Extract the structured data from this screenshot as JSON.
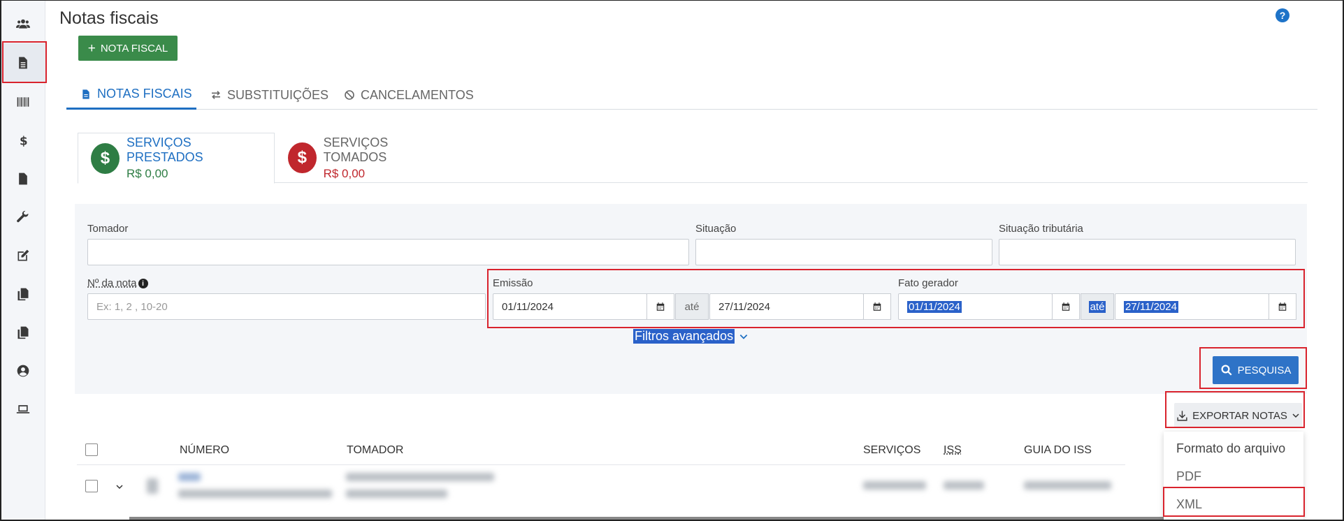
{
  "page": {
    "title": "Notas fiscais",
    "help_icon": "question-icon"
  },
  "sidebar": {
    "items": [
      {
        "icon": "users-icon"
      },
      {
        "icon": "file-text-icon",
        "active": true
      },
      {
        "icon": "barcode-icon"
      },
      {
        "icon": "dollar-icon"
      },
      {
        "icon": "file-icon"
      },
      {
        "icon": "wrench-icon"
      },
      {
        "icon": "edit-icon"
      },
      {
        "icon": "copy-icon"
      },
      {
        "icon": "copy-alt-icon"
      },
      {
        "icon": "user-circle-icon"
      },
      {
        "icon": "laptop-icon"
      }
    ]
  },
  "toolbar": {
    "new_label": "NOTA FISCAL"
  },
  "tabs": [
    {
      "label": "NOTAS FISCAIS",
      "icon": "file-text-icon",
      "active": true
    },
    {
      "label": "SUBSTITUIÇÕES",
      "icon": "exchange-icon"
    },
    {
      "label": "CANCELAMENTOS",
      "icon": "ban-icon"
    }
  ],
  "subtabs": [
    {
      "title": "SERVIÇOS PRESTADOS",
      "value": "R$ 0,00",
      "color": "#2e7d44",
      "active": true
    },
    {
      "title": "SERVIÇOS TOMADOS",
      "value": "R$ 0,00",
      "color": "#c0272d"
    }
  ],
  "filters": {
    "tomador_label": "Tomador",
    "situacao_label": "Situação",
    "situacao_tributaria_label": "Situação tributária",
    "numero_label": "Nº da nota",
    "numero_placeholder": "Ex: 1, 2 , 10-20",
    "emissao_label": "Emissão",
    "emissao_from": "01/11/2024",
    "emissao_to": "27/11/2024",
    "ate": "até",
    "fato_label": "Fato gerador",
    "fato_from": "01/11/2024",
    "fato_to": "27/11/2024",
    "advanced_label": "Filtros avançados",
    "search_label": "PESQUISA"
  },
  "export": {
    "label": "EXPORTAR NOTAS",
    "menu_title": "Formato do arquivo",
    "options": [
      "PDF",
      "XML"
    ]
  },
  "table": {
    "headers": [
      "NÚMERO",
      "TOMADOR",
      "SERVIÇOS",
      "ISS",
      "GUIA DO ISS"
    ]
  },
  "colors": {
    "primary": "#2e73c7",
    "success": "#3a8b4a",
    "danger": "#c0272d",
    "highlight": "#d9232d"
  }
}
